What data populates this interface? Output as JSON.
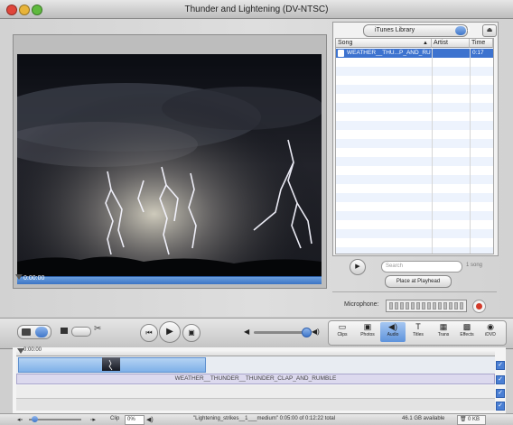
{
  "window": {
    "title": "Thunder and Lightening (DV-NTSC)"
  },
  "monitor": {
    "playhead_time": "0:00:00"
  },
  "library": {
    "source": "iTunes Library",
    "columns": [
      "Song",
      "Artist",
      "Time"
    ],
    "tracks": [
      {
        "song": "WEATHER__THU...P_AND_RU",
        "artist": "",
        "time": "0:17"
      }
    ],
    "search_placeholder": "Search",
    "count": "1 song",
    "place_button": "Place at Playhead",
    "microphone_label": "Microphone:"
  },
  "toolbar": {
    "tabs": [
      {
        "label": "Clips",
        "icon": "clips-icon",
        "glyph": "▭"
      },
      {
        "label": "Photos",
        "icon": "photos-icon",
        "glyph": "▣"
      },
      {
        "label": "Audio",
        "icon": "audio-icon",
        "glyph": "◀)"
      },
      {
        "label": "Titles",
        "icon": "titles-icon",
        "glyph": "T"
      },
      {
        "label": "Trans",
        "icon": "transitions-icon",
        "glyph": "▦"
      },
      {
        "label": "Effects",
        "icon": "effects-icon",
        "glyph": "▩"
      },
      {
        "label": "iDVD",
        "icon": "idvd-icon",
        "glyph": "◉"
      }
    ],
    "selected_tab": "Audio"
  },
  "timeline": {
    "ruler_time": "0:00:00",
    "audio_clip_label": "WEATHER__THUNDER__THUNDER_CLAP_AND_RUMBLE"
  },
  "statusbar": {
    "clip_label": "Clip",
    "clip_volume": "0%",
    "project_info": "\"Lightening_strikes__1___medium\" 0:05:00 of 0:12:22 total",
    "disk_available": "46.1 GB available",
    "trash_label": "0 KB"
  },
  "colors": {
    "accent": "#3f76c9",
    "audio_clip": "#dcd9ee",
    "video_clip": "#7eb0e8"
  }
}
